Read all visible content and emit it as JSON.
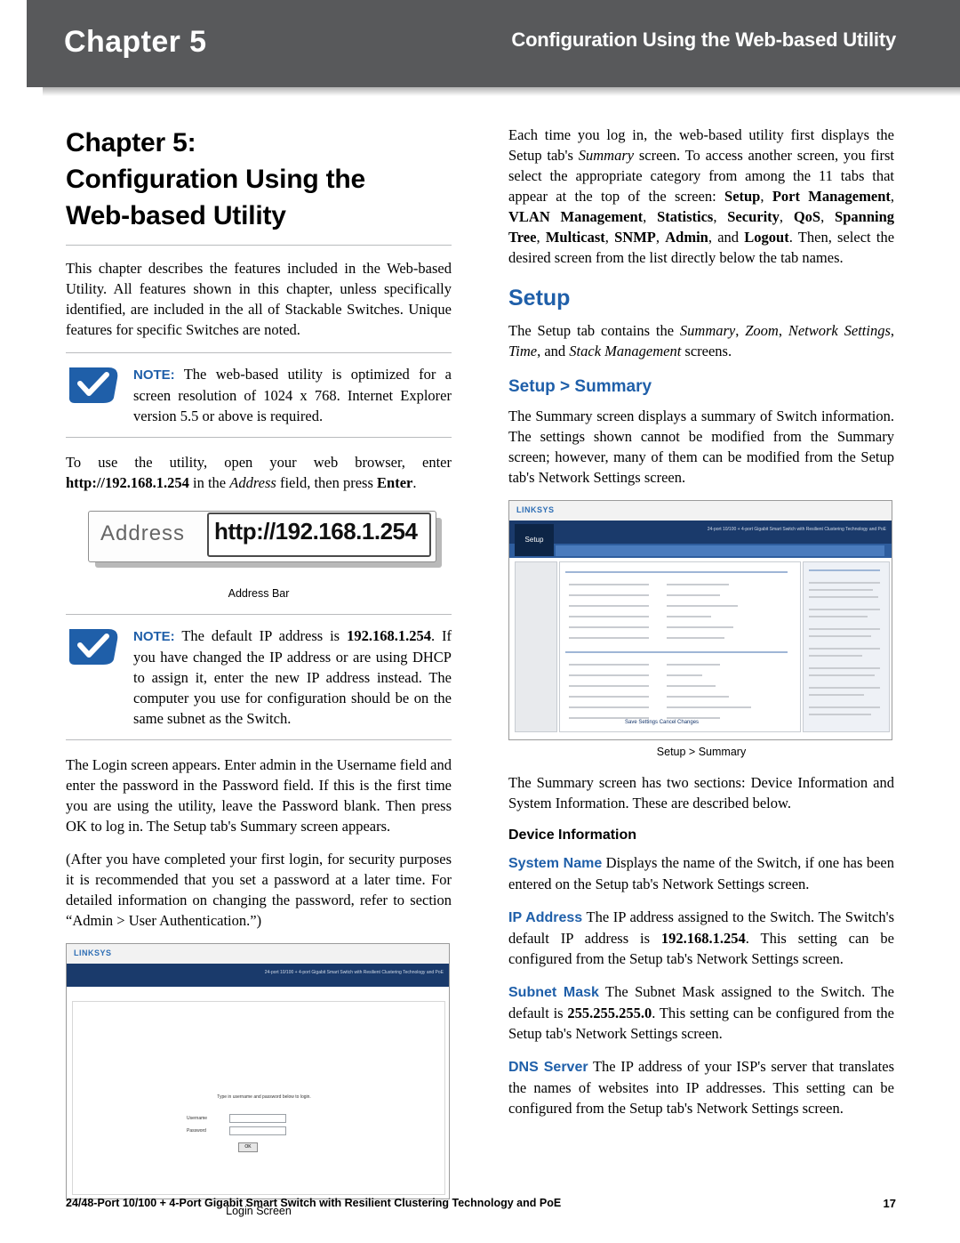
{
  "header": {
    "chapter": "Chapter 5",
    "title": "Configuration Using the Web-based Utility"
  },
  "left": {
    "heading_line1": "Chapter 5:",
    "heading_line2": "Configuration Using the",
    "heading_line3": "Web-based Utility",
    "intro": "This chapter describes the features included in the Web-based Utility. All features shown in this chapter, unless specifically identified, are included in the all of Stackable Switches. Unique features for specific Switches are noted.",
    "note1_label": "NOTE:",
    "note1_text": " The web-based utility is optimized for a screen resolution of 1024 x 768. Internet Explorer version 5.5 or above is required.",
    "para_usefirst": "To use the utility, open your web browser, enter ",
    "para_usefirst_url": "http://192.168.1.254",
    "para_usefirst_mid": " in the ",
    "para_usefirst_addr": "Address",
    "para_usefirst_end": " field, then press ",
    "para_usefirst_enter": "Enter",
    "para_usefirst_period": ".",
    "addressbar_label": "Address",
    "addressbar_url": "http://192.168.1.254",
    "addressbar_caption": "Address Bar",
    "note2_label": "NOTE:",
    "note2_text_a": " The default IP address is ",
    "note2_ip": "192.168.1.254",
    "note2_text_b": ". If you have changed the IP address or are using DHCP to assign it, enter the new IP address instead. The computer you use for configuration should be on the same subnet as the Switch.",
    "login_para": "The Login screen appears. Enter admin in the Username field and enter the password in the Password field. If this is the first time you are using the utility, leave the Password blank. Then press OK to log in. The Setup tab's Summary screen appears.",
    "security_para": "(After you have completed your first login, for security purposes it is recommended that you set a password at a later time. For detailed information on changing the password, refer to section “Admin > User Authentication.”)",
    "login_caption": "Login Screen",
    "login_shot": {
      "message": "Type in username and password below to login.",
      "username_label": "Username",
      "password_label": "Password",
      "ok_label": "OK",
      "model": "24-port 10/100 + 4-port Gigabit Smart Switch with Resilient Clustering Technology and PoE"
    }
  },
  "right": {
    "intro_a": "Each time you log in, the web-based utility first displays the Setup tab's ",
    "intro_summary": "Summary",
    "intro_b": " screen. To access another screen, you first select the appropriate category from among the 11 tabs that appear at the top of the screen: ",
    "tabs": [
      "Setup",
      "Port Management",
      "VLAN Management",
      "Statistics",
      "Security",
      "QoS",
      "Spanning Tree",
      "Multicast",
      "SNMP",
      "Admin",
      "Logout"
    ],
    "intro_c": ". Then, select the desired screen from the list directly below the tab names.",
    "setup_heading": "Setup",
    "setup_para_a": "The Setup tab contains the ",
    "setup_items": [
      "Summary",
      "Zoom",
      "Network Settings",
      "Time",
      "Stack Management"
    ],
    "setup_para_b": " screens.",
    "summary_heading": "Setup > Summary",
    "summary_para": "The Summary screen displays a summary of Switch information. The settings shown cannot be modified from the Summary screen; however, many of them can be modified from the Setup tab's Network Settings screen.",
    "summary_caption": "Setup > Summary",
    "summary_sections_para": "The Summary screen has two sections: Device Information and System Information. These are described below.",
    "device_info_heading": "Device Information",
    "system_name_term": "System Name",
    "system_name_text": "  Displays the name of the Switch, if one has been entered on the Setup tab's Network Settings screen.",
    "ip_address_term": "IP Address",
    "ip_address_text_a": "  The IP address assigned to the Switch. The Switch's default IP address is ",
    "ip_address_value": "192.168.1.254",
    "ip_address_text_b": ". This setting can be configured from the Setup tab's Network Settings screen.",
    "subnet_mask_term": "Subnet Mask",
    "subnet_mask_text_a": "  The Subnet Mask assigned to the Switch. The default is ",
    "subnet_mask_value": "255.255.255.0",
    "subnet_mask_text_b": ". This setting can be configured from the Setup tab's Network Settings screen.",
    "dns_server_term": "DNS Server",
    "dns_server_text": "  The IP address of your ISP's server that translates the names of websites into IP addresses. This setting can be configured from the Setup tab's Network Settings screen.",
    "summary_shot": {
      "setup_tab": "Setup",
      "model": "24-port 10/100 + 4-port Gigabit Smart Switch with Resilient Clustering Technology and PoE",
      "footer_buttons": "Save Settings    Cancel Changes"
    }
  },
  "footer": {
    "text": "24/48-Port 10/100 + 4-Port Gigabit Smart Switch with Resilient Clustering Technology and PoE",
    "page": "17"
  },
  "colors": {
    "header_bg": "#58595b",
    "accent_blue": "#1f5fa9",
    "note_icon_blue": "#1f5fa9"
  }
}
